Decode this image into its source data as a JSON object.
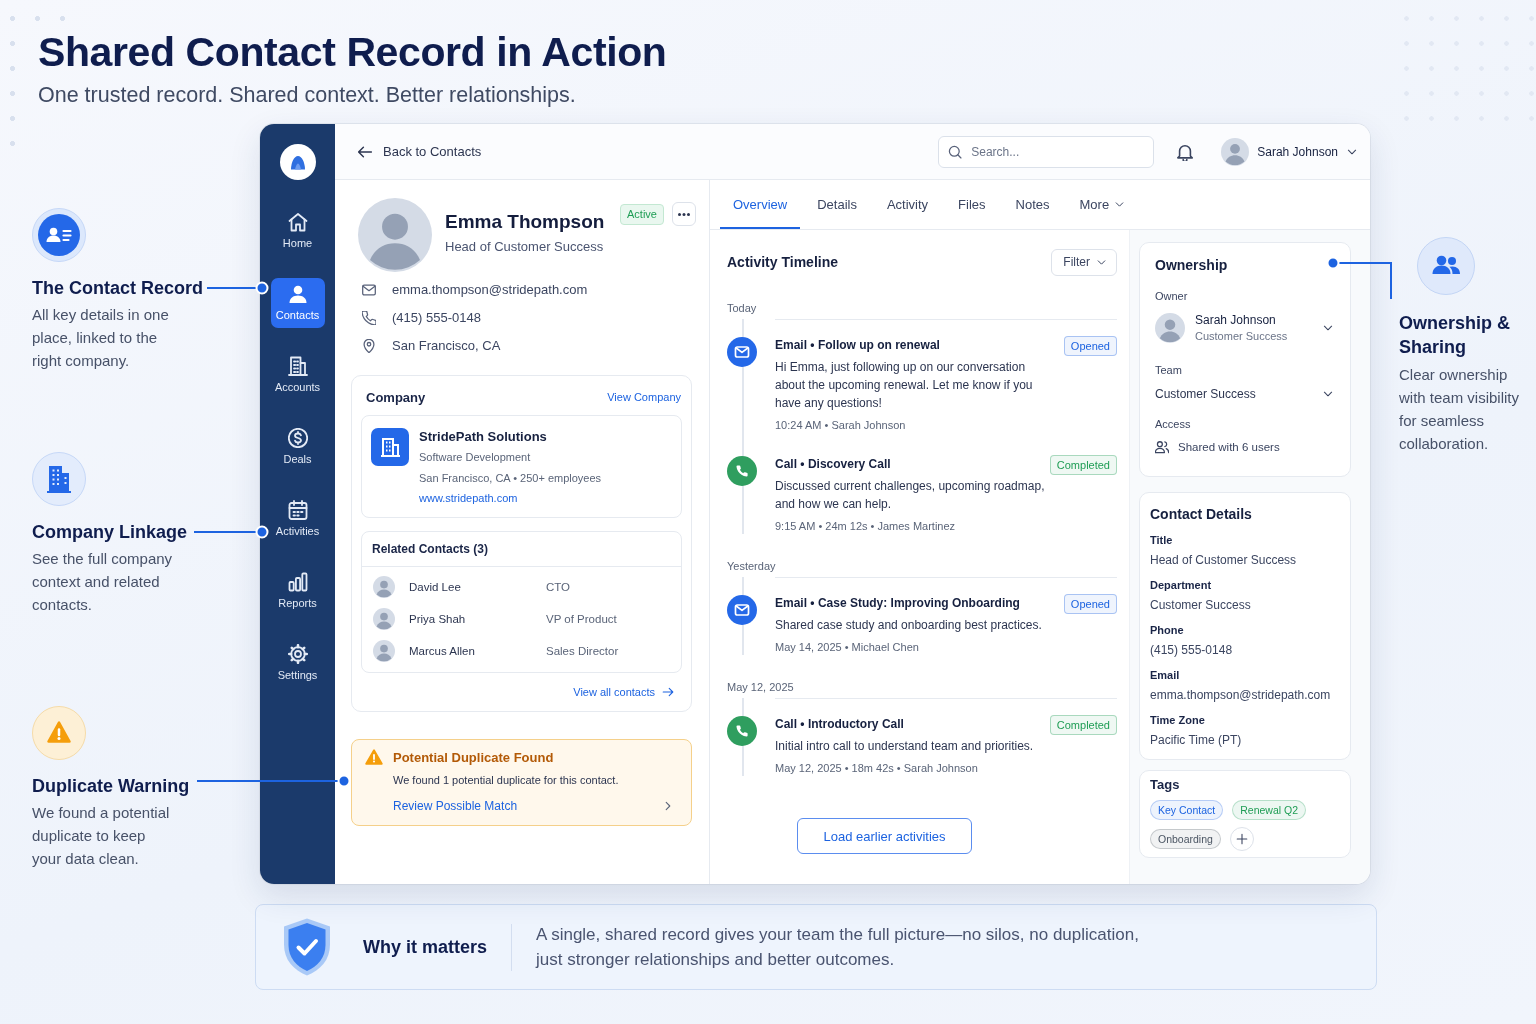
{
  "header": {
    "title": "Shared Contact Record in Action",
    "subtitle": "One trusted record. Shared context. Better relationships."
  },
  "left_callouts": [
    {
      "kind": "contact",
      "title": "The Contact Record",
      "text": "All key details in one place, linked to the right company."
    },
    {
      "kind": "company",
      "title": "Company Linkage",
      "text": "See the full company context and related contacts."
    },
    {
      "kind": "warning",
      "title": "Duplicate Warning",
      "text": "We found a potential duplicate to keep your data clean."
    }
  ],
  "right_callout": {
    "kind": "sharing",
    "title": "Ownership & Sharing",
    "text": "Clear ownership with team visibility for seamless collaboration."
  },
  "sidebar": {
    "items": [
      {
        "kind": "home",
        "label": "Home",
        "selected": false
      },
      {
        "kind": "person",
        "label": "Contacts",
        "selected": true
      },
      {
        "kind": "building",
        "label": "Accounts",
        "selected": false
      },
      {
        "kind": "dollar",
        "label": "Deals",
        "selected": false
      },
      {
        "kind": "calendar",
        "label": "Activities",
        "selected": false
      },
      {
        "kind": "chart",
        "label": "Reports",
        "selected": false
      },
      {
        "kind": "gear",
        "label": "Settings",
        "selected": false
      }
    ]
  },
  "top_bar": {
    "back_link": "Back to Contacts",
    "search": {
      "placeholder": "Search..."
    },
    "user": {
      "name": "Sarah Johnson"
    }
  },
  "contact": {
    "name": "Emma Thompson",
    "title": "Head of Customer Success",
    "status": "Active",
    "details": [
      {
        "kind": "email",
        "text": "emma.thompson@stridepath.com"
      },
      {
        "kind": "phone",
        "text": "(415) 555-0148"
      },
      {
        "kind": "location",
        "text": "San Francisco, CA"
      }
    ]
  },
  "company": {
    "heading": "Company",
    "link": "View Company",
    "name": "StridePath Solutions",
    "industry": "Software Development",
    "info": "San Francisco, CA • 250+ employees",
    "website": "www.stridepath.com"
  },
  "related_contacts": {
    "heading": "Related Contacts (3)",
    "rows": [
      {
        "name": "David Lee",
        "role": "CTO"
      },
      {
        "name": "Priya Shah",
        "role": "VP of Product"
      },
      {
        "name": "Marcus Allen",
        "role": "Sales Director"
      }
    ],
    "link": "View all contacts"
  },
  "duplicate_warning": {
    "title": "Potential Duplicate Found",
    "text": "We found 1 potential duplicate for this contact.",
    "link": "Review Possible Match"
  },
  "tabs": [
    {
      "kind": "tab",
      "label": "Overview",
      "selected": true
    },
    {
      "kind": "tab",
      "label": "Details",
      "selected": false
    },
    {
      "kind": "tab",
      "label": "Activity",
      "selected": false
    },
    {
      "kind": "tab",
      "label": "Files",
      "selected": false
    },
    {
      "kind": "tab",
      "label": "Notes",
      "selected": false
    },
    {
      "kind": "menu",
      "label": "More",
      "selected": false
    }
  ],
  "timeline": {
    "title": "Activity Timeline",
    "filter": "Filter",
    "groups": [
      {
        "label": "Today",
        "activities": [
          {
            "kind": "email",
            "title": "Email • Follow up on renewal",
            "body": "Hi Emma, just following up on our conversation about the upcoming renewal. Let me know if you have any questions!",
            "meta": "10:24 AM • Sarah Johnson",
            "status": {
              "label": "Opened",
              "color": "#1d63e0"
            }
          },
          {
            "kind": "call",
            "title": "Call • Discovery Call",
            "body": "Discussed current challenges, upcoming roadmap, and how we can help.",
            "meta": "9:15 AM • 24m 12s • James Martinez",
            "status": {
              "label": "Completed",
              "color": "#1f9d55"
            }
          }
        ]
      },
      {
        "label": "Yesterday",
        "activities": [
          {
            "kind": "email",
            "title": "Email • Case Study: Improving Onboarding",
            "body": "Shared case study and onboarding best practices.",
            "meta": "May 14, 2025 • Michael Chen",
            "status": {
              "label": "Opened",
              "color": "#1d63e0"
            }
          }
        ]
      },
      {
        "label": "May 12, 2025",
        "activities": [
          {
            "kind": "call",
            "title": "Call • Introductory Call",
            "body": "Initial intro call to understand team and priorities.",
            "meta": "May 12, 2025 • 18m 42s • Sarah Johnson",
            "status": {
              "label": "Completed",
              "color": "#1f9d55"
            }
          }
        ]
      }
    ],
    "load_more": "Load earlier activities"
  },
  "ownership": {
    "title": "Ownership",
    "owner_label": "Owner",
    "owner": {
      "name": "Sarah Johnson",
      "team": "Customer Success"
    },
    "team_label": "Team",
    "team": "Customer Success",
    "access_label": "Access",
    "access": "Shared with 6 users"
  },
  "contact_details": {
    "title": "Contact Details",
    "fields": [
      {
        "label": "Title",
        "value": "Head of Customer Success"
      },
      {
        "label": "Department",
        "value": "Customer Success"
      },
      {
        "label": "Phone",
        "value": "(415) 555-0148"
      },
      {
        "label": "Email",
        "value": "emma.thompson@stridepath.com"
      },
      {
        "label": "Time Zone",
        "value": "Pacific Time (PT)"
      }
    ]
  },
  "tags": {
    "title": "Tags",
    "items": [
      {
        "label": "Key Contact",
        "color": "#1d63e0"
      },
      {
        "label": "Renewal Q2",
        "color": "#1f9d55"
      },
      {
        "label": "Onboarding",
        "color": "#4b5563"
      }
    ]
  },
  "banner": {
    "title": "Why it matters",
    "text": "A single, shared record gives your team the full picture—no silos, no duplication, just stronger relationships and better outcomes."
  }
}
